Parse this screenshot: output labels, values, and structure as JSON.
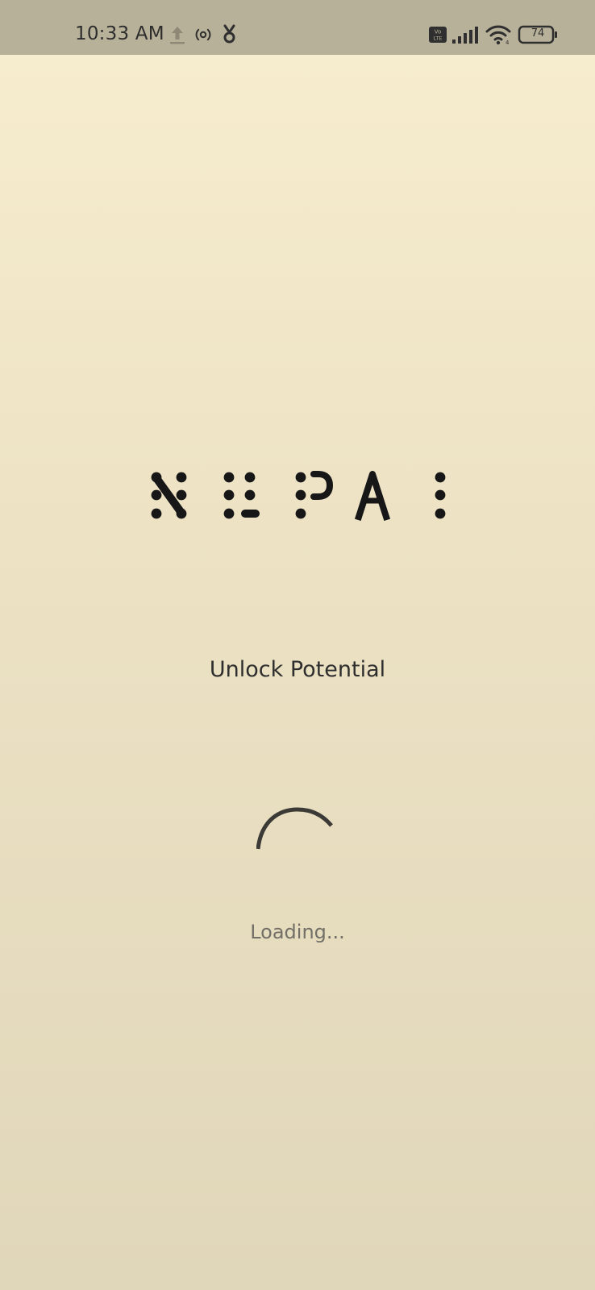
{
  "status_bar": {
    "time": "10:33 AM",
    "battery_level": "74",
    "left_icons": [
      "upload-icon",
      "hotspot-icon",
      "notification-app-icon"
    ],
    "right_icons": [
      "volte-icon",
      "signal-icon",
      "wifi-icon",
      "battery-icon"
    ],
    "background": "#b8b199"
  },
  "splash": {
    "brand": "NEPAI",
    "tagline": "Unlock Potential",
    "loading_text": "Loading...",
    "spinner_icon": "loading-spinner-icon",
    "accent_color": "#3b3a37"
  }
}
